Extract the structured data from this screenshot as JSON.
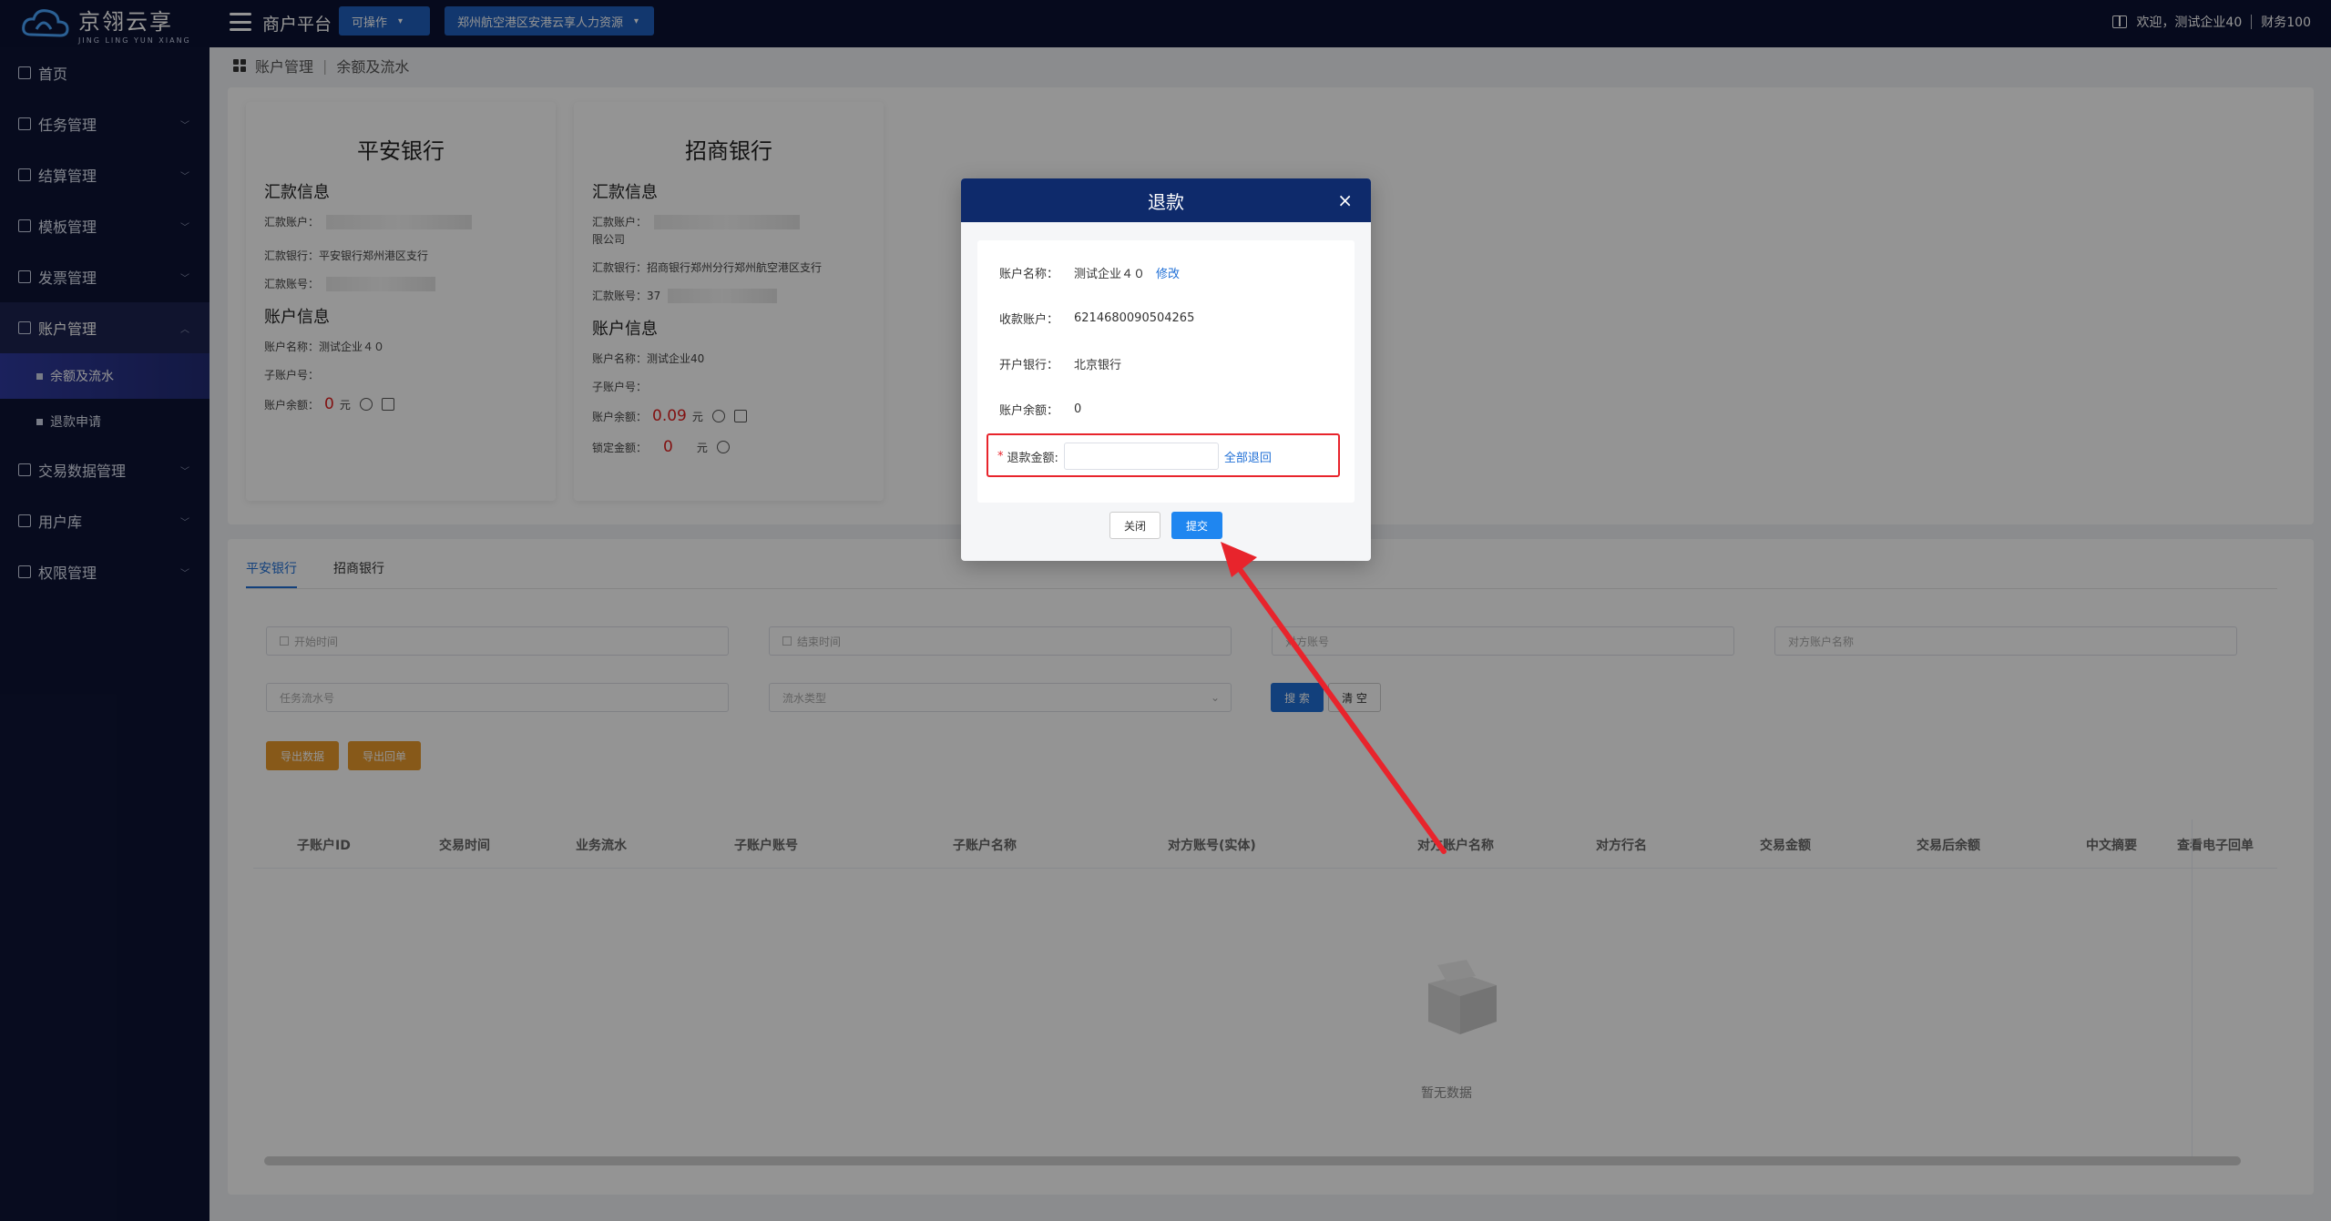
{
  "app": {
    "logo_title": "京翎云享",
    "logo_sub": "JING LING YUN XIANG",
    "platform": "商户平台",
    "dropdown_status": "可操作",
    "dropdown_company": "郑州航空港区安港云享人力资源",
    "welcome": "欢迎，测试企业40",
    "user": "财务100"
  },
  "sidebar": {
    "items": [
      {
        "label": "首页"
      },
      {
        "label": "任务管理"
      },
      {
        "label": "结算管理"
      },
      {
        "label": "模板管理"
      },
      {
        "label": "发票管理"
      },
      {
        "label": "账户管理"
      },
      {
        "label": "交易数据管理"
      },
      {
        "label": "用户库"
      },
      {
        "label": "权限管理"
      }
    ],
    "sub_items": [
      {
        "label": "余额及流水"
      },
      {
        "label": "退款申请"
      }
    ]
  },
  "breadcrumb": {
    "level1": "账户管理",
    "level2": "余额及流水"
  },
  "banks": [
    {
      "name": "平安银行",
      "remit_title": "汇款信息",
      "remit_account_label": "汇款账户：",
      "remit_bank_label": "汇款银行：",
      "remit_bank_value": "平安银行郑州港区支行",
      "remit_no_label": "汇款账号：",
      "account_title": "账户信息",
      "account_name_label": "账户名称：",
      "account_name_value": "测试企业４０",
      "sub_account_label": "子账户号：",
      "balance_label": "账户余额：",
      "balance_value": "0",
      "unit": "元"
    },
    {
      "name": "招商银行",
      "remit_title": "汇款信息",
      "remit_account_label": "汇款账户：",
      "remit_account_suffix": "限公司",
      "remit_bank_label": "汇款银行：",
      "remit_bank_value": "招商银行郑州分行郑州航空港区支行",
      "remit_no_label": "汇款账号：",
      "remit_no_value": "37",
      "account_title": "账户信息",
      "account_name_label": "账户名称：",
      "account_name_value": "测试企业40",
      "sub_account_label": "子账户号：",
      "balance_label": "账户余额：",
      "balance_value": "0.09",
      "unit": "元",
      "locked_label": "锁定金额：",
      "locked_value": "0"
    }
  ],
  "tabs": [
    {
      "label": "平安银行"
    },
    {
      "label": "招商银行"
    }
  ],
  "filters": {
    "start_time": "开始时间",
    "end_time": "结束时间",
    "counter_account": "对方账号",
    "counter_account_name": "对方账户名称",
    "task_order": "任务流水号",
    "flow_type": "流水类型",
    "search": "搜 索",
    "clear": "清 空",
    "export_data": "导出数据",
    "export_receipt": "导出回单"
  },
  "table": {
    "headers": [
      "子账户ID",
      "交易时间",
      "业务流水",
      "子账户账号",
      "子账户名称",
      "对方账号(实体)",
      "对方账户名称",
      "对方行名",
      "交易金额",
      "交易后余额",
      "中文摘要",
      "查看电子回单"
    ],
    "empty": "暂无数据"
  },
  "modal": {
    "title": "退款",
    "account_name_label": "账户名称：",
    "account_name_value": "测试企业４０",
    "edit_link": "修改",
    "receive_account_label": "收款账户：",
    "receive_account_value": "6214680090504265",
    "bank_label": "开户银行：",
    "bank_value": "北京银行",
    "balance_label": "账户余额：",
    "balance_value": "0",
    "refund_amount_label": "退款金额:",
    "refund_all": "全部退回",
    "close_btn": "关闭",
    "submit_btn": "提交"
  },
  "colors": {
    "topbar": "#0b1233",
    "sidebar": "#0d1435",
    "primary": "#1f6fd6",
    "highlight_red": "#e8242c",
    "amount_red": "#e02020",
    "modal_head": "#0e2a6b"
  }
}
